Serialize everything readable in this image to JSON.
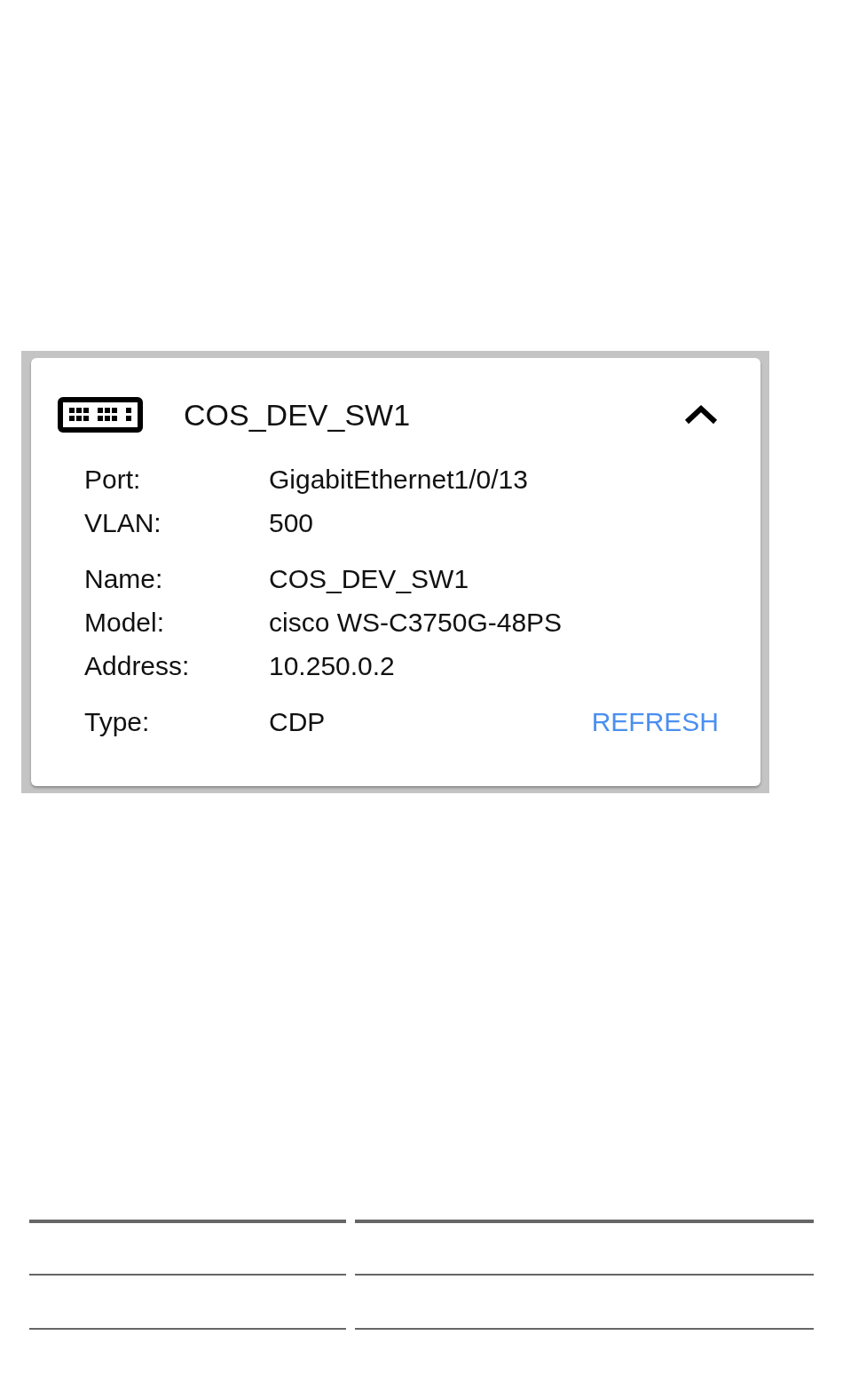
{
  "device": {
    "title": "COS_DEV_SW1",
    "expanded": true,
    "groups": [
      [
        {
          "label": "Port:",
          "value": "GigabitEthernet1/0/13"
        },
        {
          "label": "VLAN:",
          "value": "500"
        }
      ],
      [
        {
          "label": "Name:",
          "value": "COS_DEV_SW1"
        },
        {
          "label": "Model:",
          "value": "cisco WS-C3750G-48PS"
        },
        {
          "label": "Address:",
          "value": "10.250.0.2"
        }
      ]
    ],
    "type": {
      "label": "Type:",
      "value": "CDP"
    },
    "action": "REFRESH"
  }
}
